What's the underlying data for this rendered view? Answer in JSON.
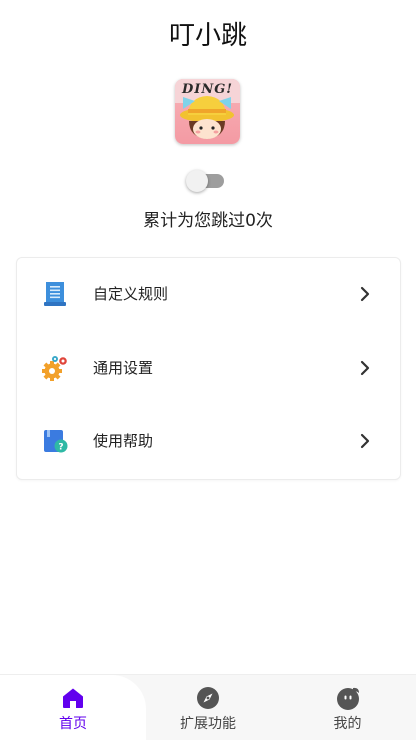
{
  "header": {
    "title": "叮小跳",
    "logo_text": "DING!"
  },
  "service": {
    "toggle_state": "off"
  },
  "stats": {
    "skip_summary": "累计为您跳过0次"
  },
  "menu": {
    "items": [
      {
        "label": "自定义规则",
        "icon": "document-list-icon"
      },
      {
        "label": "通用设置",
        "icon": "gears-icon"
      },
      {
        "label": "使用帮助",
        "icon": "help-book-icon"
      }
    ]
  },
  "tabbar": {
    "active_tab": "首页",
    "tabs": [
      {
        "label": "首页",
        "icon": "home-icon"
      },
      {
        "label": "扩展功能",
        "icon": "compass-icon"
      },
      {
        "label": "我的",
        "icon": "profile-face-icon"
      }
    ]
  },
  "colors": {
    "accent": "#6200ee",
    "toggle_track": "#9e9e9e",
    "toggle_thumb": "#f1f1f1",
    "tab_bar_bg": "#f7f7f7"
  }
}
